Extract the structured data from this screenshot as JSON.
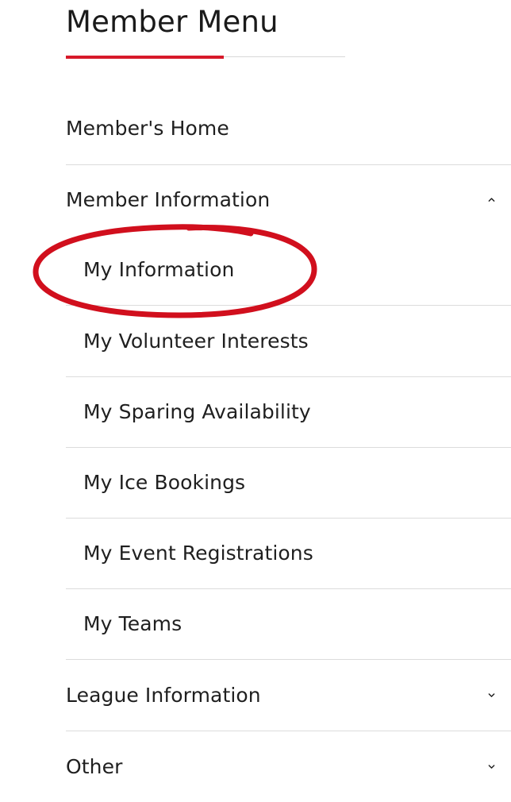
{
  "menu": {
    "title": "Member Menu",
    "items": [
      {
        "label": "Member's Home",
        "chevron": "none"
      },
      {
        "label": "Member Information",
        "chevron": "up"
      },
      {
        "label": "League Information",
        "chevron": "down"
      },
      {
        "label": "Other",
        "chevron": "down"
      }
    ],
    "sub_items": [
      {
        "label": "My Information",
        "highlighted": true
      },
      {
        "label": "My Volunteer Interests"
      },
      {
        "label": "My Sparing Availability"
      },
      {
        "label": "My Ice Bookings"
      },
      {
        "label": "My Event Registrations"
      },
      {
        "label": "My Teams"
      }
    ]
  },
  "colors": {
    "accent": "#d7192a",
    "annotation": "#d10f1d",
    "divider": "#dcdcdc",
    "text": "#1f1f1f"
  },
  "icons": {
    "expanded": "chevron-up-icon",
    "collapsed": "chevron-down-icon"
  }
}
